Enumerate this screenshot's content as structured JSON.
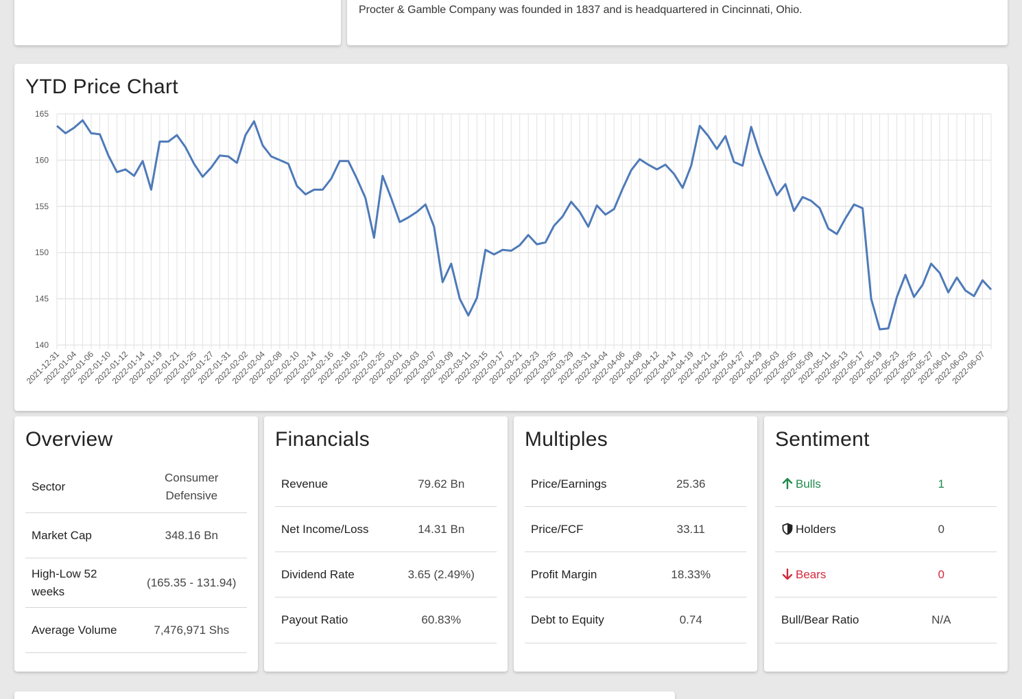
{
  "description": {
    "text": "Procter & Gamble Company was founded in 1837 and is headquartered in Cincinnati, Ohio."
  },
  "chart": {
    "title": "YTD Price Chart",
    "line_color": "#4e7ab8"
  },
  "chart_data": {
    "type": "line",
    "title": "YTD Price Chart",
    "xlabel": "",
    "ylabel": "",
    "ylim": [
      140,
      165
    ],
    "yticks": [
      140,
      145,
      150,
      155,
      160,
      165
    ],
    "grid": true,
    "x_tick_labels": [
      "2021-12-31",
      "2022-01-04",
      "2022-01-06",
      "2022-01-10",
      "2022-01-12",
      "2022-01-14",
      "2022-01-19",
      "2022-01-21",
      "2022-01-25",
      "2022-01-27",
      "2022-01-31",
      "2022-02-02",
      "2022-02-04",
      "2022-02-08",
      "2022-02-10",
      "2022-02-14",
      "2022-02-16",
      "2022-02-18",
      "2022-02-23",
      "2022-02-25",
      "2022-03-01",
      "2022-03-03",
      "2022-03-07",
      "2022-03-09",
      "2022-03-11",
      "2022-03-15",
      "2022-03-17",
      "2022-03-21",
      "2022-03-23",
      "2022-03-25",
      "2022-03-29",
      "2022-03-31",
      "2022-04-04",
      "2022-04-06",
      "2022-04-08",
      "2022-04-12",
      "2022-04-14",
      "2022-04-19",
      "2022-04-21",
      "2022-04-25",
      "2022-04-27",
      "2022-04-29",
      "2022-05-03",
      "2022-05-05",
      "2022-05-09",
      "2022-05-11",
      "2022-05-13",
      "2022-05-17",
      "2022-05-19",
      "2022-05-23",
      "2022-05-25",
      "2022-05-27",
      "2022-06-01",
      "2022-06-03",
      "2022-06-07"
    ],
    "series": [
      {
        "values": [
          163.7,
          162.9,
          163.5,
          164.3,
          162.9,
          162.8,
          160.5,
          158.7,
          159.0,
          158.3,
          159.9,
          156.8,
          162.0,
          162.0,
          162.7,
          161.4,
          159.6,
          158.2,
          159.2,
          160.5,
          160.4,
          159.7,
          162.7,
          164.2,
          161.6,
          160.4,
          160.0,
          159.6,
          157.2,
          156.3,
          156.8,
          156.8,
          158.0,
          159.9,
          159.9,
          158.0,
          155.9,
          151.6,
          158.3,
          155.9,
          153.3,
          153.8,
          154.4,
          155.2,
          152.8,
          146.8,
          148.8,
          145.0,
          143.2,
          145.1,
          150.3,
          149.8,
          150.3,
          150.2,
          150.8,
          151.9,
          150.9,
          151.1,
          152.9,
          153.9,
          155.5,
          154.4,
          152.8,
          155.1,
          154.1,
          154.7,
          156.9,
          158.9,
          160.1,
          159.5,
          159.0,
          159.5,
          158.5,
          157.0,
          159.4,
          163.7,
          162.6,
          161.2,
          162.6,
          159.8,
          159.4,
          163.6,
          160.7,
          158.4,
          156.2,
          157.4,
          154.5,
          156.0,
          155.6,
          154.8,
          152.6,
          152.0,
          153.7,
          155.2,
          154.8,
          145.0,
          141.7,
          141.8,
          145.2,
          147.6,
          145.2,
          146.5,
          148.8,
          147.8,
          145.7,
          147.3,
          145.9,
          145.3,
          147.0,
          146.0
        ]
      }
    ]
  },
  "overview": {
    "title": "Overview",
    "rows": [
      {
        "label": "Sector",
        "value": "Consumer Defensive"
      },
      {
        "label": "Market Cap",
        "value": "348.16 Bn"
      },
      {
        "label": "High-Low 52 weeks",
        "value": "(165.35 - 131.94)"
      },
      {
        "label": "Average Volume",
        "value": "7,476,971 Shs"
      }
    ]
  },
  "financials": {
    "title": "Financials",
    "rows": [
      {
        "label": "Revenue",
        "value": "79.62 Bn"
      },
      {
        "label": "Net Income/Loss",
        "value": "14.31 Bn"
      },
      {
        "label": "Dividend Rate",
        "value": "3.65 (2.49%)"
      },
      {
        "label": "Payout Ratio",
        "value": "60.83%"
      }
    ]
  },
  "multiples": {
    "title": "Multiples",
    "rows": [
      {
        "label": "Price/Earnings",
        "value": "25.36"
      },
      {
        "label": "Price/FCF",
        "value": "33.11"
      },
      {
        "label": "Profit Margin",
        "value": "18.33%"
      },
      {
        "label": "Debt to Equity",
        "value": "0.74"
      }
    ]
  },
  "sentiment": {
    "title": "Sentiment",
    "bulls": {
      "label": "Bulls",
      "value": "1",
      "color": "#1f8a4c",
      "icon": "arrow-up-icon"
    },
    "holders": {
      "label": "Holders",
      "value": "0",
      "icon": "shield-icon"
    },
    "bears": {
      "label": "Bears",
      "value": "0",
      "color": "#d2283c",
      "icon": "arrow-down-icon"
    },
    "ratio": {
      "label": "Bull/Bear Ratio",
      "value": "N/A"
    }
  }
}
